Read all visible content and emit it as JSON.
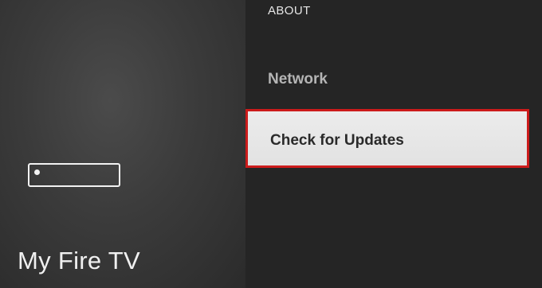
{
  "sidebar": {
    "title": "My Fire TV",
    "icon": "fire-tv-device-icon"
  },
  "menu": {
    "items": [
      {
        "label": "ABOUT",
        "state": "partial"
      },
      {
        "label": "Network",
        "state": "normal"
      },
      {
        "label": "Check for Updates",
        "state": "focused"
      }
    ]
  },
  "colors": {
    "focus_border": "#cc1b1b",
    "focus_background": "#e8e8e8",
    "menu_background": "#252525"
  }
}
